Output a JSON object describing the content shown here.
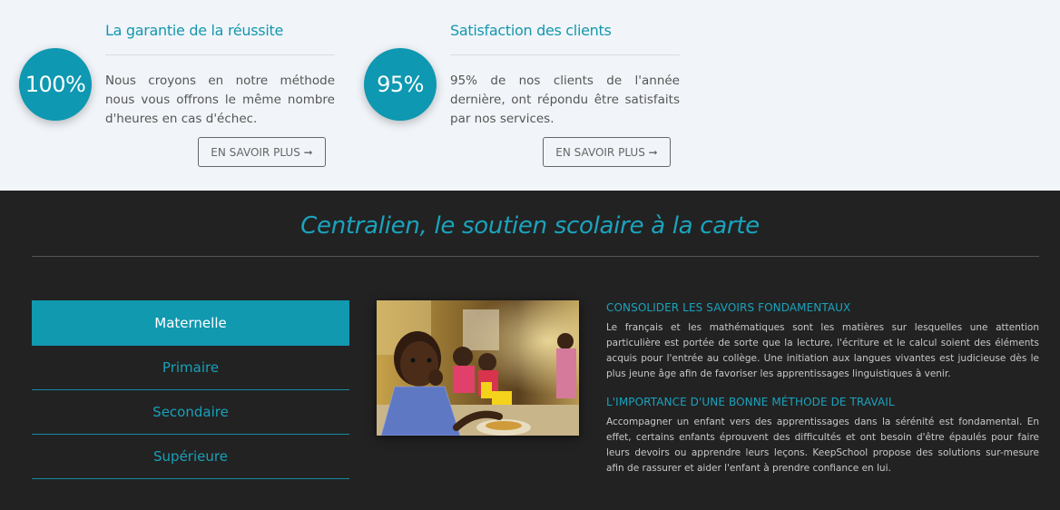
{
  "features": [
    {
      "percent": "100%",
      "title": "La garantie de la réussite",
      "text": "Nous croyons en notre méthode nous vous offrons le même nombre d'heures en cas d'échec.",
      "button": "EN SAVOIR PLUS ➞"
    },
    {
      "percent": "95%",
      "title": "Satisfaction des clients",
      "text": "95% de nos clients de l'année dernière, ont répondu être satisfaits par nos services.",
      "button": "EN SAVOIR PLUS ➞"
    }
  ],
  "section": {
    "headline": "Centralien, le soutien scolaire à la carte"
  },
  "menu": {
    "items": [
      {
        "label": "Maternelle"
      },
      {
        "label": "Primaire"
      },
      {
        "label": "Secondaire"
      },
      {
        "label": "Supérieure"
      }
    ],
    "active_index": 0
  },
  "content": {
    "blocks": [
      {
        "title": "CONSOLIDER LES SAVOIRS FONDAMENTAUX",
        "text": "Le français et les mathématiques sont les matières sur lesquelles une attention particulière est portée de sorte que la lecture, l'écriture et le calcul soient des éléments acquis pour l'entrée au collège. Une initiation aux langues vivantes est judicieuse dès le plus jeune âge afin de favoriser les apprentissages linguistiques à venir."
      },
      {
        "title": "L'IMPORTANCE D'UNE BONNE MÉTHODE DE TRAVAIL",
        "text": "Accompagner un enfant vers des apprentissages dans la sérénité est fondamental. En effet, certains enfants éprouvent des difficultés et ont besoin d'être épaulés pour faire leurs devoirs ou apprendre leurs leçons. KeepSchool propose des solutions sur-mesure afin de rassurer et aider l'enfant à prendre confiance en lui."
      }
    ]
  },
  "colors": {
    "accent": "#1199b0",
    "dark_bg": "#222222",
    "light_bg": "#f1f5f9"
  }
}
